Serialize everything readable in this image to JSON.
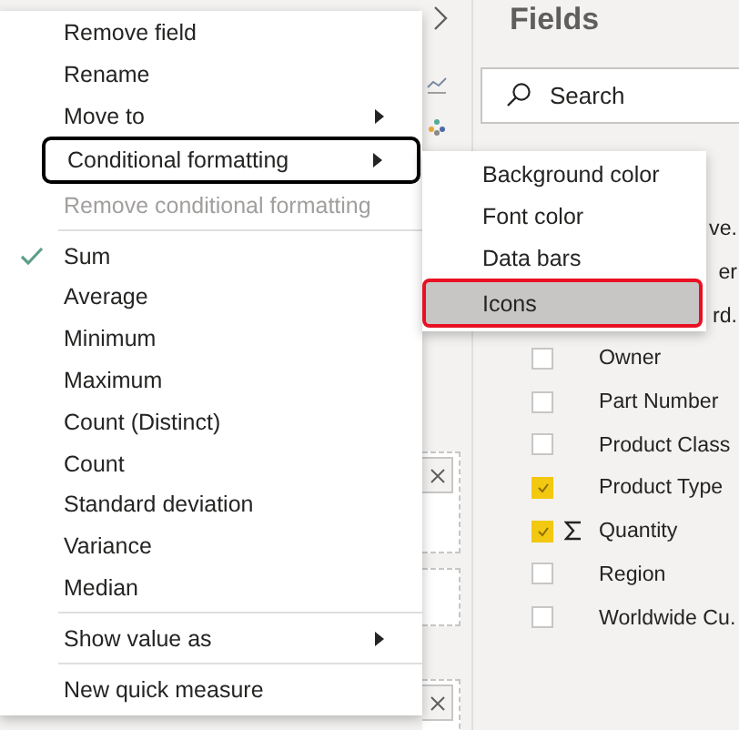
{
  "fields_pane": {
    "title": "Fields",
    "search": {
      "placeholder": "Search"
    },
    "fields": [
      {
        "kind": "clipped",
        "name": "ve."
      },
      {
        "kind": "clipped",
        "name": "er"
      },
      {
        "kind": "clipped",
        "name": "rd."
      },
      {
        "kind": "field",
        "name": "Owner",
        "checked": false
      },
      {
        "kind": "field",
        "name": "Part Number",
        "checked": false
      },
      {
        "kind": "field",
        "name": "Product Class",
        "checked": false
      },
      {
        "kind": "field",
        "name": "Product Type",
        "checked": true
      },
      {
        "kind": "measure",
        "name": "Quantity",
        "checked": true
      },
      {
        "kind": "field",
        "name": "Region",
        "checked": false
      },
      {
        "kind": "field",
        "name": "Worldwide Cu.",
        "checked": false
      }
    ]
  },
  "context_menu": {
    "items": [
      {
        "kind": "item",
        "label": "Remove field",
        "submenu": false,
        "disabled": false,
        "checked": false,
        "focused": false
      },
      {
        "kind": "item",
        "label": "Rename",
        "submenu": false,
        "disabled": false,
        "checked": false,
        "focused": false
      },
      {
        "kind": "item",
        "label": "Move to",
        "submenu": true,
        "disabled": false,
        "checked": false,
        "focused": false
      },
      {
        "kind": "item",
        "label": "Conditional formatting",
        "submenu": true,
        "disabled": false,
        "checked": false,
        "focused": true
      },
      {
        "kind": "item",
        "label": "Remove conditional formatting",
        "submenu": false,
        "disabled": true,
        "checked": false,
        "focused": false
      },
      {
        "kind": "divider"
      },
      {
        "kind": "item",
        "label": "Sum",
        "submenu": false,
        "disabled": false,
        "checked": true,
        "focused": false
      },
      {
        "kind": "item",
        "label": "Average",
        "submenu": false,
        "disabled": false,
        "checked": false,
        "focused": false
      },
      {
        "kind": "item",
        "label": "Minimum",
        "submenu": false,
        "disabled": false,
        "checked": false,
        "focused": false
      },
      {
        "kind": "item",
        "label": "Maximum",
        "submenu": false,
        "disabled": false,
        "checked": false,
        "focused": false
      },
      {
        "kind": "item",
        "label": "Count (Distinct)",
        "submenu": false,
        "disabled": false,
        "checked": false,
        "focused": false
      },
      {
        "kind": "item",
        "label": "Count",
        "submenu": false,
        "disabled": false,
        "checked": false,
        "focused": false
      },
      {
        "kind": "item",
        "label": "Standard deviation",
        "submenu": false,
        "disabled": false,
        "checked": false,
        "focused": false
      },
      {
        "kind": "item",
        "label": "Variance",
        "submenu": false,
        "disabled": false,
        "checked": false,
        "focused": false
      },
      {
        "kind": "item",
        "label": "Median",
        "submenu": false,
        "disabled": false,
        "checked": false,
        "focused": false
      },
      {
        "kind": "divider"
      },
      {
        "kind": "item",
        "label": "Show value as",
        "submenu": true,
        "disabled": false,
        "checked": false,
        "focused": false
      },
      {
        "kind": "divider"
      },
      {
        "kind": "item",
        "label": "New quick measure",
        "submenu": false,
        "disabled": false,
        "checked": false,
        "focused": false
      }
    ]
  },
  "submenu": {
    "items": [
      {
        "label": "Background color",
        "selected": false
      },
      {
        "label": "Font color",
        "selected": false
      },
      {
        "label": "Data bars",
        "selected": false
      },
      {
        "label": "Icons",
        "selected": true
      }
    ]
  }
}
